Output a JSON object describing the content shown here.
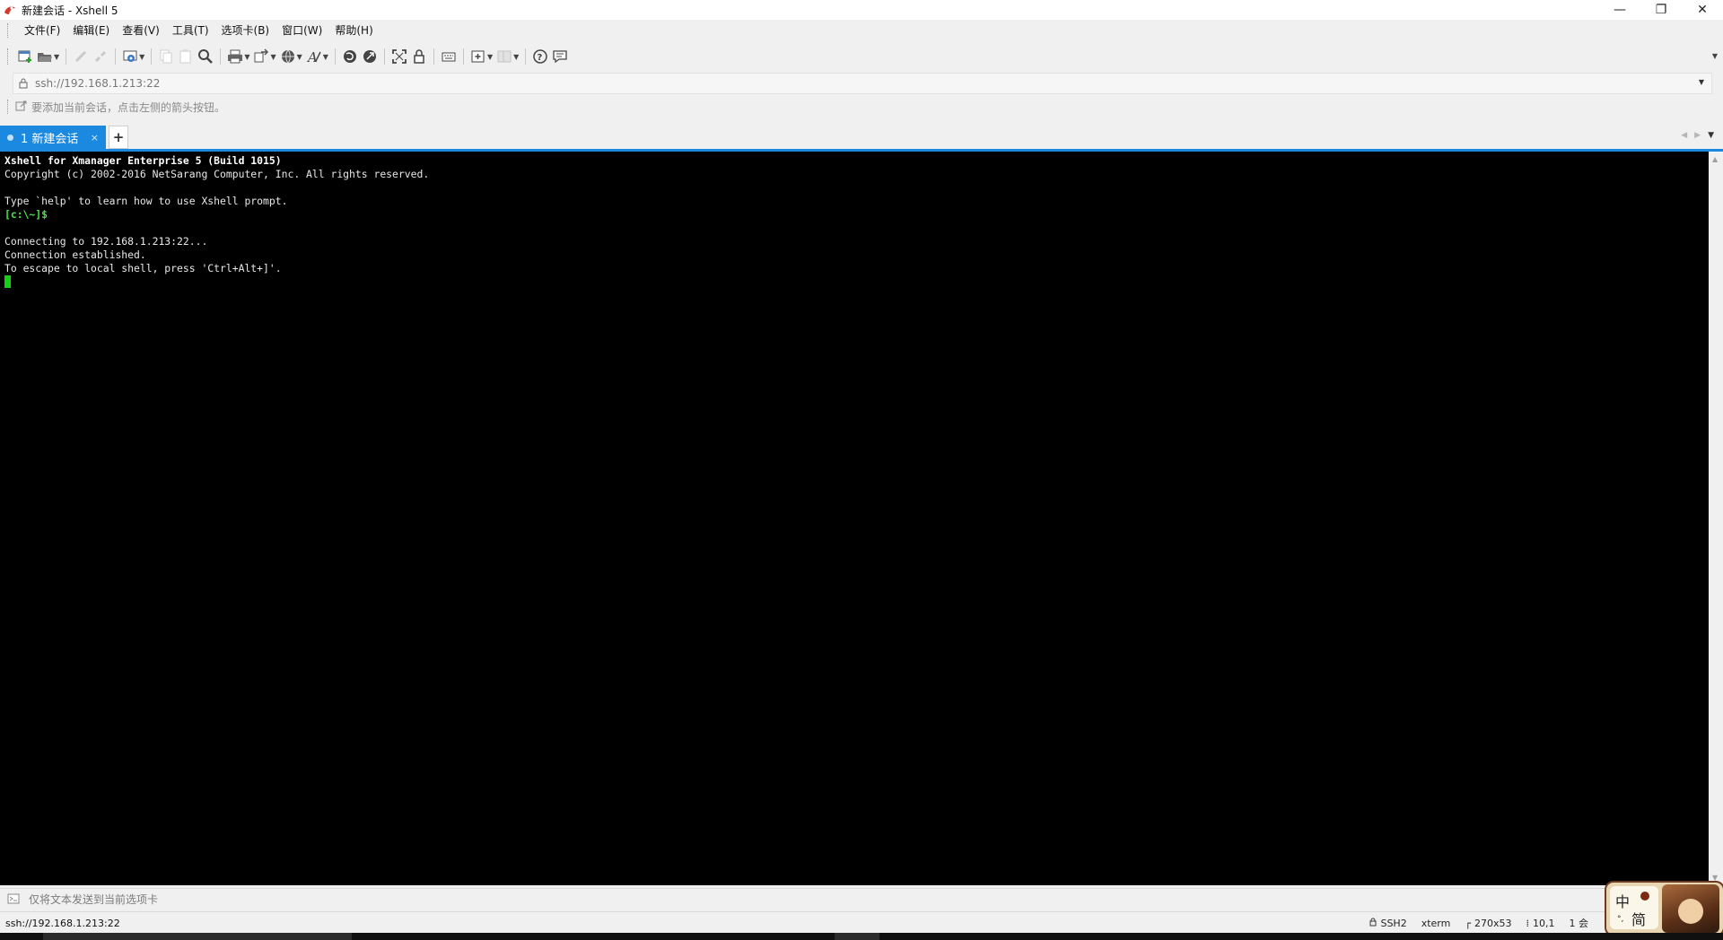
{
  "window": {
    "title": "新建会话 - Xshell 5",
    "controls": {
      "minimize": "—",
      "restore": "❐",
      "close": "✕"
    }
  },
  "menu": {
    "items": [
      "文件(F)",
      "编辑(E)",
      "查看(V)",
      "工具(T)",
      "选项卡(B)",
      "窗口(W)",
      "帮助(H)"
    ]
  },
  "address": {
    "value": "ssh://192.168.1.213:22"
  },
  "hint": {
    "text": "要添加当前会话，点击左侧的箭头按钮。"
  },
  "tabs": {
    "active_label": "1 新建会话",
    "close": "×",
    "add": "+"
  },
  "terminal": {
    "lines": [
      "Xshell for Xmanager Enterprise 5 (Build 1015)",
      "Copyright (c) 2002-2016 NetSarang Computer, Inc. All rights reserved.",
      "",
      "Type `help' to learn how to use Xshell prompt.",
      "[c:\\~]$",
      "",
      "Connecting to 192.168.1.213:22...",
      "Connection established.",
      "To escape to local shell, press 'Ctrl+Alt+]'."
    ]
  },
  "compose": {
    "text": "仅将文本发送到当前选项卡"
  },
  "status": {
    "connection": "ssh://192.168.1.213:22",
    "protocol": "SSH2",
    "terminal_type": "xterm",
    "size": "270x53",
    "cursor_pos": "10,1",
    "sessions": "1 会"
  },
  "ime": {
    "lang": "中",
    "mode": "简",
    "dot": "°,"
  },
  "colors": {
    "accent": "#1c89e0",
    "terminal_bg": "#000000",
    "prompt": "#48e048",
    "cursor": "#14d014"
  }
}
